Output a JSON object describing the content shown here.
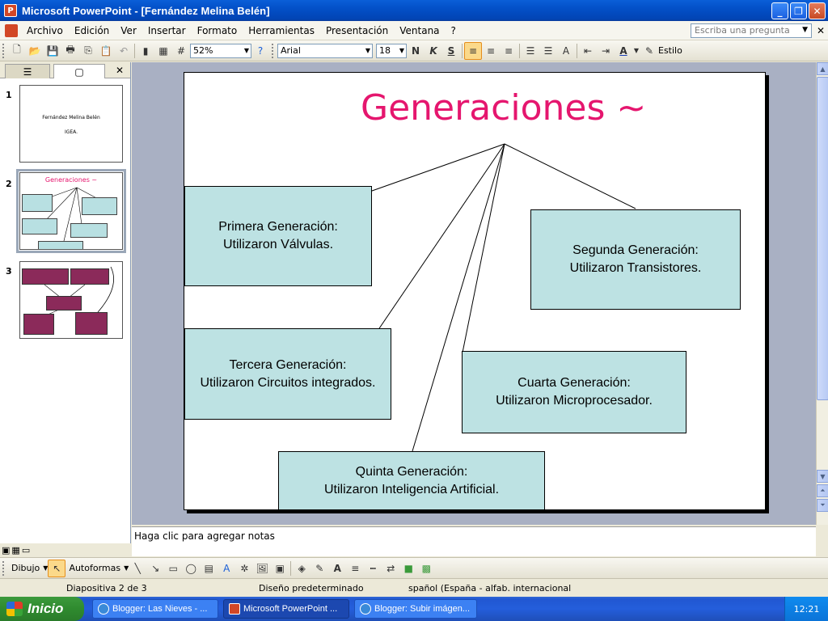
{
  "window": {
    "title": "Microsoft PowerPoint - [Fernández Melina Belén]"
  },
  "menu": {
    "items": [
      "Archivo",
      "Edición",
      "Ver",
      "Insertar",
      "Formato",
      "Herramientas",
      "Presentación",
      "Ventana",
      "?"
    ],
    "ask_placeholder": "Escriba una pregunta"
  },
  "toolbar": {
    "zoom": "52%",
    "font": "Arial",
    "font_size": "18",
    "bold": "N",
    "italic": "K",
    "underline": "S",
    "style_label": "Estilo"
  },
  "slides_pane": {
    "slides": [
      {
        "number": "1",
        "title": "Fernández Melina Belén",
        "subtitle": "IGEA."
      },
      {
        "number": "2",
        "title": "Generaciones ~"
      },
      {
        "number": "3",
        "title": ""
      }
    ]
  },
  "slide": {
    "title": "Generaciones ~",
    "boxes": [
      {
        "line1": "Primera Generación:",
        "line2": "Utilizaron Válvulas."
      },
      {
        "line1": "Segunda Generación:",
        "line2": "Utilizaron Transistores."
      },
      {
        "line1": "Tercera Generación:",
        "line2": "Utilizaron Circuitos integrados."
      },
      {
        "line1": "Cuarta Generación:",
        "line2": "Utilizaron Microprocesador."
      },
      {
        "line1": "Quinta Generación:",
        "line2": "Utilizaron Inteligencia Artificial."
      }
    ],
    "title_color": "#e5166e",
    "box_color": "#bde2e3"
  },
  "notes": {
    "placeholder": "Haga clic para agregar notas"
  },
  "drawing_toolbar": {
    "dibujo": "Dibujo",
    "autoformas": "Autoformas"
  },
  "status": {
    "slide": "Diapositiva 2 de 3",
    "design": "Diseño predeterminado",
    "language": "spañol (España - alfab. internacional"
  },
  "taskbar": {
    "start": "Inicio",
    "tasks": [
      "Blogger: Las Nieves - ...",
      "Microsoft PowerPoint ...",
      "Blogger: Subir imágen..."
    ],
    "clock": "12:21"
  }
}
